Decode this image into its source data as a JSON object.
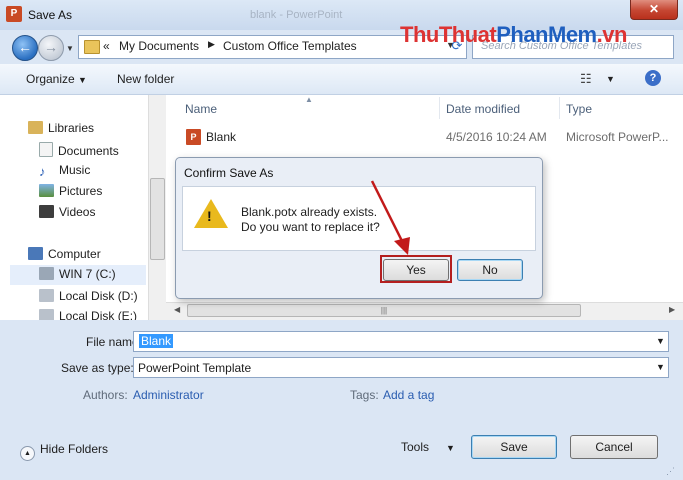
{
  "window": {
    "title": "Save As",
    "background_title": "blank - PowerPoint"
  },
  "watermark": {
    "part1": "ThuThuat",
    "part2": "PhanMem",
    "part3": ".vn"
  },
  "address": {
    "chevron": "«",
    "crumbs": [
      "My Documents",
      "Custom Office Templates"
    ],
    "search_placeholder": "Search Custom Office Templates"
  },
  "toolbar": {
    "organize": "Organize",
    "new_folder": "New folder"
  },
  "nav": {
    "items": [
      {
        "label": "Libraries",
        "icon": "libraries-icon"
      },
      {
        "label": "Documents",
        "icon": "documents-icon"
      },
      {
        "label": "Music",
        "icon": "music-icon"
      },
      {
        "label": "Pictures",
        "icon": "pictures-icon"
      },
      {
        "label": "Videos",
        "icon": "videos-icon"
      },
      {
        "label": "Computer",
        "icon": "computer-icon"
      },
      {
        "label": "WIN 7 (C:)",
        "icon": "drive-c-icon"
      },
      {
        "label": "Local Disk (D:)",
        "icon": "drive-icon"
      },
      {
        "label": "Local Disk (E:)",
        "icon": "drive-icon"
      }
    ]
  },
  "columns": {
    "name": "Name",
    "date": "Date modified",
    "type": "Type"
  },
  "files": [
    {
      "name": "Blank",
      "date": "4/5/2016 10:24 AM",
      "type": "Microsoft PowerP..."
    }
  ],
  "form": {
    "file_name_label": "File name:",
    "file_name_value": "Blank",
    "save_as_type_label": "Save as type:",
    "save_as_type_value": "PowerPoint Template",
    "authors_label": "Authors:",
    "authors_value": "Administrator",
    "tags_label": "Tags:",
    "tags_value": "Add a tag"
  },
  "footer": {
    "hide_folders": "Hide Folders",
    "tools": "Tools",
    "save": "Save",
    "cancel": "Cancel"
  },
  "confirm": {
    "title": "Confirm Save As",
    "message_line1": "Blank.potx already exists.",
    "message_line2": "Do you want to replace it?",
    "yes": "Yes",
    "no": "No"
  },
  "colors": {
    "highlight_border": "#b41f1f",
    "selection": "#3399ff",
    "link": "#2a5db0"
  }
}
